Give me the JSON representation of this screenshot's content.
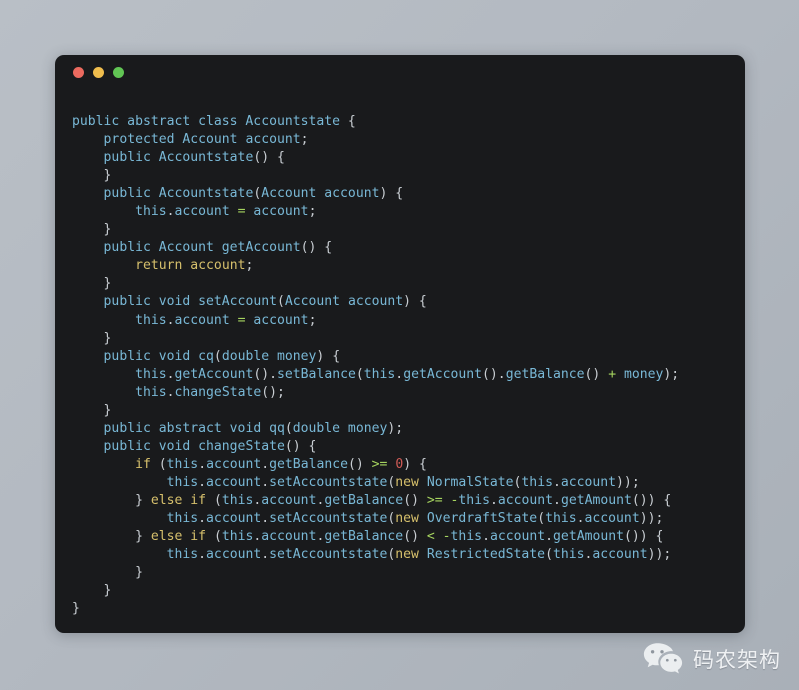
{
  "window": {
    "name": "code-snippet-window",
    "background_color": "#191a1c",
    "controls": [
      {
        "name": "close",
        "color": "#ec6a5f"
      },
      {
        "name": "minimize",
        "color": "#f0bd4d"
      },
      {
        "name": "maximize",
        "color": "#61c554"
      }
    ]
  },
  "page": {
    "background_color": "#b3b9c1"
  },
  "theme": {
    "identifier_color": "#79b8d6",
    "keyword_color": "#d6c06c",
    "operator_color": "#a6d45f",
    "number_color": "#cf5b56",
    "punctuation_color": "#c9ced3"
  },
  "code": {
    "language": "java",
    "lines": [
      "public abstract class Accountstate {",
      "    protected Account account;",
      "    public Accountstate() {",
      "    }",
      "    public Accountstate(Account account) {",
      "        this.account = account;",
      "    }",
      "    public Account getAccount() {",
      "        return account;",
      "    }",
      "    public void setAccount(Account account) {",
      "        this.account = account;",
      "    }",
      "    public void cq(double money) {",
      "        this.getAccount().setBalance(this.getAccount().getBalance() + money);",
      "        this.changeState();",
      "    }",
      "    public abstract void qq(double money);",
      "    public void changeState() {",
      "        if (this.account.getBalance() >= 0) {",
      "            this.account.setAccountstate(new NormalState(this.account));",
      "        } else if (this.account.getBalance() >= -this.account.getAmount()) {",
      "            this.account.setAccountstate(new OverdraftState(this.account));",
      "        } else if (this.account.getBalance() < -this.account.getAmount()) {",
      "            this.account.setAccountstate(new RestrictedState(this.account));",
      "        }",
      "    }",
      "}"
    ],
    "html": "<span class=\"t-id\">public abstract class Accountstate</span> <span class=\"t-pn\">{</span>\n    <span class=\"t-id\">protected Account account</span><span class=\"t-pn\">;</span>\n    <span class=\"t-id\">public Accountstate</span><span class=\"t-pn\">() {</span>\n    <span class=\"t-pn\">}</span>\n    <span class=\"t-id\">public Accountstate</span><span class=\"t-pn\">(</span><span class=\"t-id\">Account account</span><span class=\"t-pn\">) {</span>\n        <span class=\"t-id\">this</span><span class=\"t-pn\">.</span><span class=\"t-id\">account</span> <span class=\"t-op\">=</span> <span class=\"t-id\">account</span><span class=\"t-pn\">;</span>\n    <span class=\"t-pn\">}</span>\n    <span class=\"t-id\">public Account getAccount</span><span class=\"t-pn\">() {</span>\n        <span class=\"t-kw\">return</span> <span class=\"t-kw\">account</span><span class=\"t-pn\">;</span>\n    <span class=\"t-pn\">}</span>\n    <span class=\"t-id\">public void setAccount</span><span class=\"t-pn\">(</span><span class=\"t-id\">Account account</span><span class=\"t-pn\">) {</span>\n        <span class=\"t-id\">this</span><span class=\"t-pn\">.</span><span class=\"t-id\">account</span> <span class=\"t-op\">=</span> <span class=\"t-id\">account</span><span class=\"t-pn\">;</span>\n    <span class=\"t-pn\">}</span>\n    <span class=\"t-id\">public void cq</span><span class=\"t-pn\">(</span><span class=\"t-id\">double money</span><span class=\"t-pn\">) {</span>\n        <span class=\"t-id\">this</span><span class=\"t-pn\">.</span><span class=\"t-id\">getAccount</span><span class=\"t-pn\">().</span><span class=\"t-id\">setBalance</span><span class=\"t-pn\">(</span><span class=\"t-id\">this</span><span class=\"t-pn\">.</span><span class=\"t-id\">getAccount</span><span class=\"t-pn\">().</span><span class=\"t-id\">getBalance</span><span class=\"t-pn\">()</span> <span class=\"t-op\">+</span> <span class=\"t-id\">money</span><span class=\"t-pn\">);</span>\n        <span class=\"t-id\">this</span><span class=\"t-pn\">.</span><span class=\"t-id\">changeState</span><span class=\"t-pn\">();</span>\n    <span class=\"t-pn\">}</span>\n    <span class=\"t-id\">public abstract void qq</span><span class=\"t-pn\">(</span><span class=\"t-id\">double money</span><span class=\"t-pn\">);</span>\n    <span class=\"t-id\">public void changeState</span><span class=\"t-pn\">() {</span>\n        <span class=\"t-kw\">if</span> <span class=\"t-pn\">(</span><span class=\"t-id\">this</span><span class=\"t-pn\">.</span><span class=\"t-id\">account</span><span class=\"t-pn\">.</span><span class=\"t-id\">getBalance</span><span class=\"t-pn\">()</span> <span class=\"t-op\">&gt;=</span> <span class=\"t-num\">0</span><span class=\"t-pn\">) {</span>\n            <span class=\"t-id\">this</span><span class=\"t-pn\">.</span><span class=\"t-id\">account</span><span class=\"t-pn\">.</span><span class=\"t-id\">setAccountstate</span><span class=\"t-pn\">(</span><span class=\"t-kw\">new</span> <span class=\"t-id\">NormalState</span><span class=\"t-pn\">(</span><span class=\"t-id\">this</span><span class=\"t-pn\">.</span><span class=\"t-id\">account</span><span class=\"t-pn\">));</span>\n        <span class=\"t-pn\">}</span> <span class=\"t-kw\">else if</span> <span class=\"t-pn\">(</span><span class=\"t-id\">this</span><span class=\"t-pn\">.</span><span class=\"t-id\">account</span><span class=\"t-pn\">.</span><span class=\"t-id\">getBalance</span><span class=\"t-pn\">()</span> <span class=\"t-op\">&gt;=</span> <span class=\"t-op\">-</span><span class=\"t-id\">this</span><span class=\"t-pn\">.</span><span class=\"t-id\">account</span><span class=\"t-pn\">.</span><span class=\"t-id\">getAmount</span><span class=\"t-pn\">()) {</span>\n            <span class=\"t-id\">this</span><span class=\"t-pn\">.</span><span class=\"t-id\">account</span><span class=\"t-pn\">.</span><span class=\"t-id\">setAccountstate</span><span class=\"t-pn\">(</span><span class=\"t-kw\">new</span> <span class=\"t-id\">OverdraftState</span><span class=\"t-pn\">(</span><span class=\"t-id\">this</span><span class=\"t-pn\">.</span><span class=\"t-id\">account</span><span class=\"t-pn\">));</span>\n        <span class=\"t-pn\">}</span> <span class=\"t-kw\">else if</span> <span class=\"t-pn\">(</span><span class=\"t-id\">this</span><span class=\"t-pn\">.</span><span class=\"t-id\">account</span><span class=\"t-pn\">.</span><span class=\"t-id\">getBalance</span><span class=\"t-pn\">()</span> <span class=\"t-op\">&lt;</span> <span class=\"t-op\">-</span><span class=\"t-id\">this</span><span class=\"t-pn\">.</span><span class=\"t-id\">account</span><span class=\"t-pn\">.</span><span class=\"t-id\">getAmount</span><span class=\"t-pn\">()) {</span>\n            <span class=\"t-id\">this</span><span class=\"t-pn\">.</span><span class=\"t-id\">account</span><span class=\"t-pn\">.</span><span class=\"t-id\">setAccountstate</span><span class=\"t-pn\">(</span><span class=\"t-kw\">new</span> <span class=\"t-id\">RestrictedState</span><span class=\"t-pn\">(</span><span class=\"t-id\">this</span><span class=\"t-pn\">.</span><span class=\"t-id\">account</span><span class=\"t-pn\">));</span>\n        <span class=\"t-pn\">}</span>\n    <span class=\"t-pn\">}</span>\n<span class=\"t-pn\">}</span>"
  },
  "watermark": {
    "icon": "wechat-icon",
    "label": "码农架构"
  }
}
